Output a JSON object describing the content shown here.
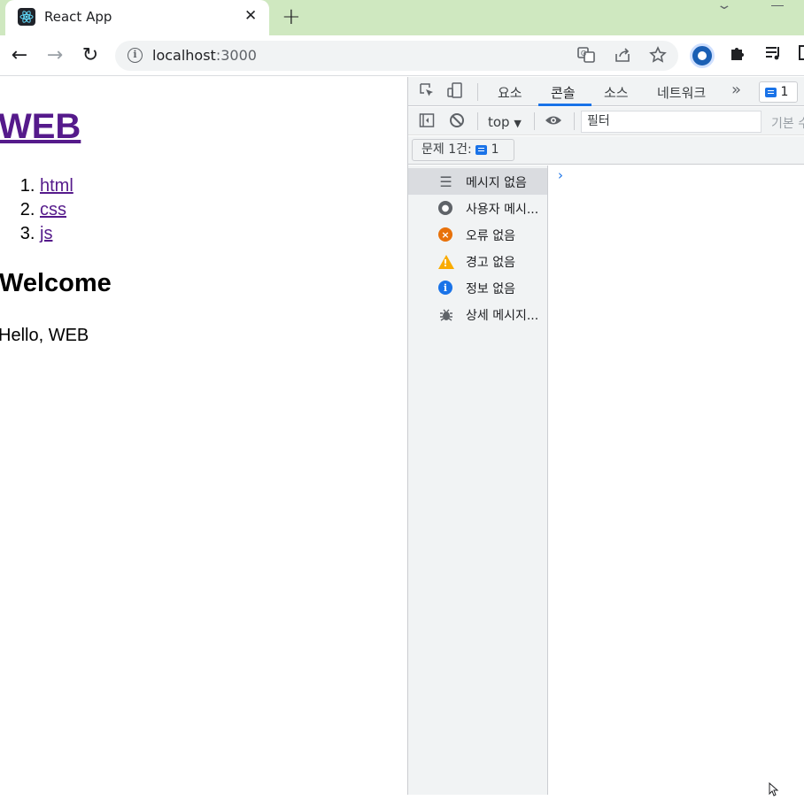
{
  "browser": {
    "tab": {
      "title": "React App",
      "close_glyph": "✕"
    },
    "new_tab_glyph": "+",
    "nav": {
      "back": "←",
      "forward": "→",
      "reload": "↻"
    },
    "address": {
      "host": "localhost",
      "port": ":3000"
    },
    "extensions": [
      "translate-icon",
      "share-icon",
      "bookmark-star-icon",
      "profile-extension-icon",
      "puzzle-icon",
      "reading-list-icon"
    ]
  },
  "page": {
    "heading": "WEB",
    "nav_items": [
      "html",
      "css",
      "js"
    ],
    "article_title": "Welcome",
    "article_body": "Hello, WEB"
  },
  "devtools": {
    "tabs": [
      "요소",
      "콘솔",
      "소스",
      "네트워크"
    ],
    "active_tab": "콘솔",
    "more_glyph": "»",
    "badge_count": "1",
    "console_bar": {
      "context": "top",
      "filter_placeholder": "필터",
      "levels": "기본 수"
    },
    "issues": {
      "label": "문제 1건:",
      "count": "1"
    },
    "sidebar": [
      {
        "label": "메시지 없음",
        "icon": "list-icon"
      },
      {
        "label": "사용자 메시...",
        "icon": "user-icon"
      },
      {
        "label": "오류 없음",
        "icon": "error-icon"
      },
      {
        "label": "경고 없음",
        "icon": "warning-icon"
      },
      {
        "label": "정보 없음",
        "icon": "info-icon"
      },
      {
        "label": "상세 메시지...",
        "icon": "bug-icon"
      }
    ],
    "prompt_glyph": "›"
  },
  "colors": {
    "accent": "#1a73e8",
    "visited_link": "#551a8b",
    "tabstrip": "#cfe8c0"
  }
}
